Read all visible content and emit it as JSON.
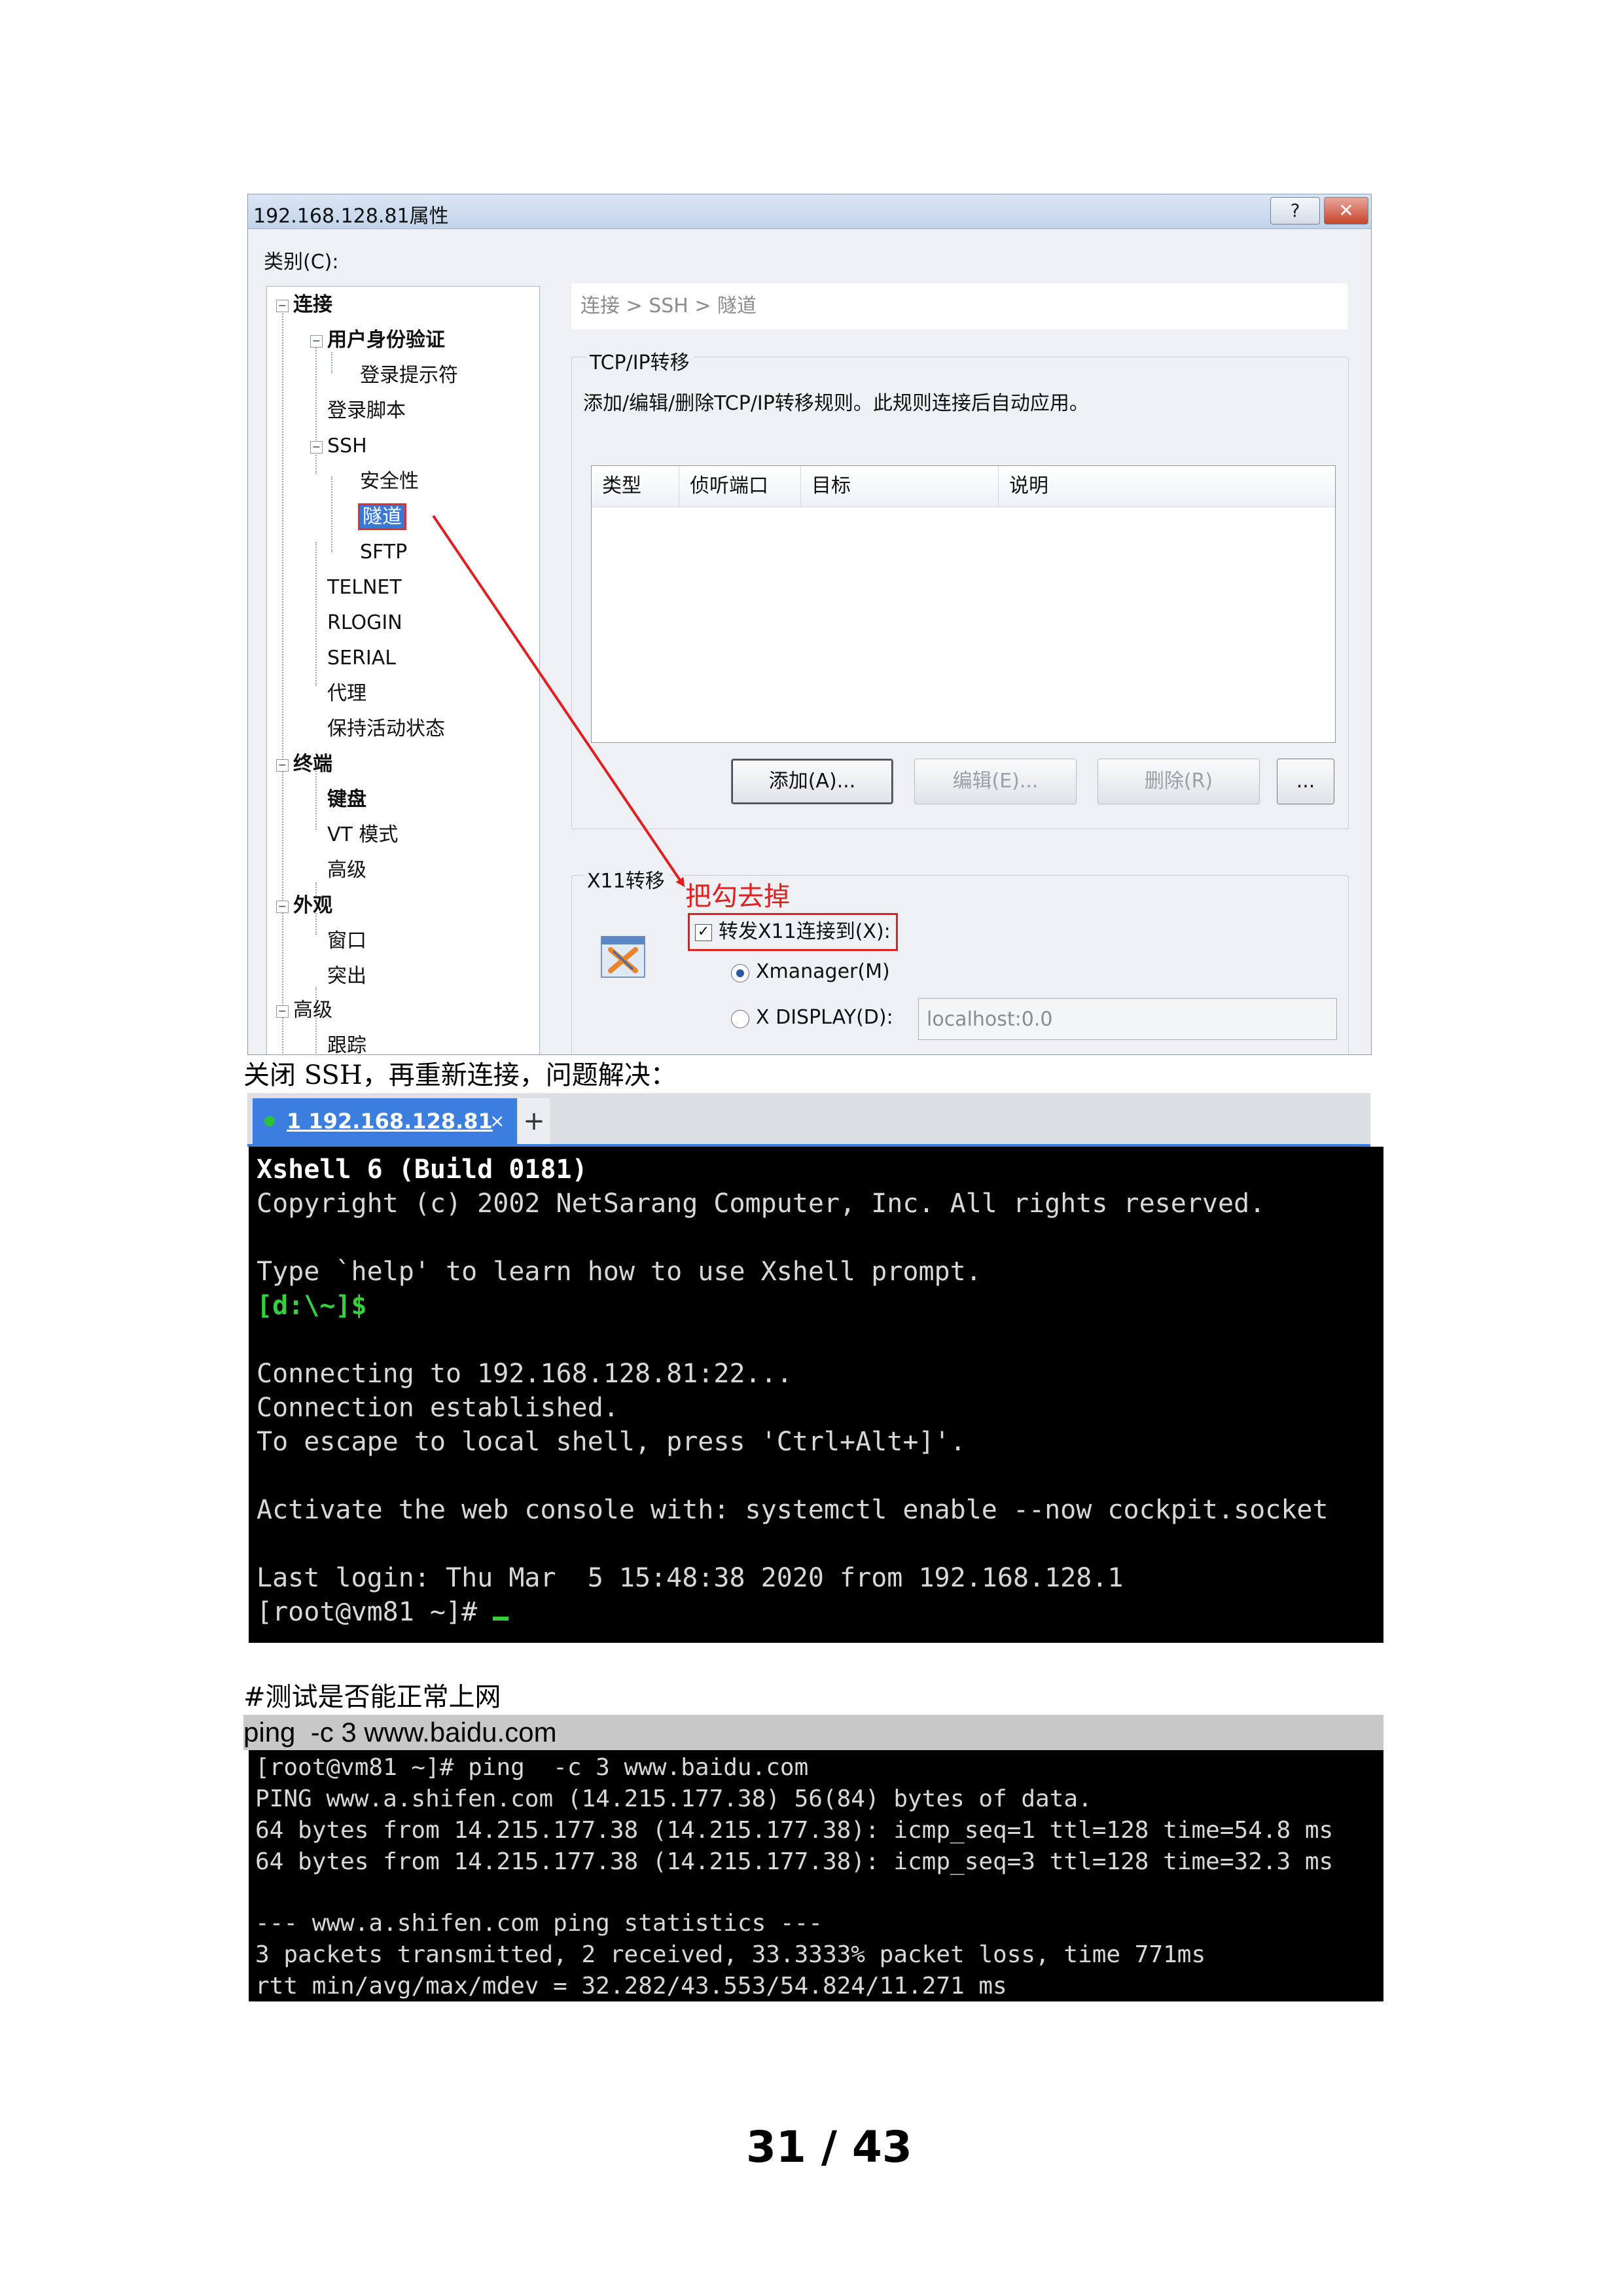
{
  "dialog": {
    "title": "192.168.128.81属性",
    "help_label": "?",
    "close_label": "✕",
    "category_label": "类别(C):",
    "tree": {
      "connection": "连接",
      "auth": "用户身份验证",
      "login_prompt": "登录提示符",
      "login_script": "登录脚本",
      "ssh": "SSH",
      "security": "安全性",
      "tunnel": "隧道",
      "sftp": "SFTP",
      "telnet": "TELNET",
      "rlogin": "RLOGIN",
      "serial": "SERIAL",
      "proxy": "代理",
      "keepalive": "保持活动状态",
      "terminal": "终端",
      "keyboard": "键盘",
      "vt_mode": "VT 模式",
      "advanced": "高级",
      "appearance": "外观",
      "window": "窗口",
      "highlight": "突出",
      "advanced2": "高级",
      "trace": "跟踪"
    },
    "breadcrumb": "连接 > SSH > 隧道",
    "tcp": {
      "title": "TCP/IP转移",
      "description": "添加/编辑/删除TCP/IP转移规则。此规则连接后自动应用。",
      "columns": [
        "类型",
        "侦听端口",
        "目标",
        "说明"
      ],
      "add_label": "添加(A)...",
      "edit_label": "编辑(E)...",
      "delete_label": "删除(R)",
      "more_label": "..."
    },
    "x11": {
      "title": "X11转移",
      "annotation": "把勾去掉",
      "forward_label": "转发X11连接到(X):",
      "forward_checked": true,
      "xmanager_label": "Xmanager(M)",
      "xdisplay_label": "X DISPLAY(D):",
      "display_value": "localhost:0.0",
      "selected": "xmanager"
    }
  },
  "text": {
    "close_ssh": "关闭 SSH，再重新连接，问题解决：",
    "test_internet": "#测试是否能正常上网",
    "ping_command": "ping  -c 3 www.baidu.com"
  },
  "xshell": {
    "tab_label": "1 192.168.128.81",
    "tab_close": "×",
    "new_tab": "+",
    "lines": [
      "Xshell 6 (Build 0181)",
      "Copyright (c) 2002 NetSarang Computer, Inc. All rights reserved.",
      "Type `help' to learn how to use Xshell prompt.",
      "[d:\\~]$",
      "Connecting to 192.168.128.81:22...",
      "Connection established.",
      "To escape to local shell, press 'Ctrl+Alt+]'.",
      "Activate the web console with: systemctl enable --now cockpit.socket",
      "Last login: Thu Mar  5 15:48:38 2020 from 192.168.128.1",
      "[root@vm81 ~]# "
    ]
  },
  "ping_output": {
    "lines": [
      "[root@vm81 ~]# ping  -c 3 www.baidu.com",
      "PING www.a.shifen.com (14.215.177.38) 56(84) bytes of data.",
      "64 bytes from 14.215.177.38 (14.215.177.38): icmp_seq=1 ttl=128 time=54.8 ms",
      "64 bytes from 14.215.177.38 (14.215.177.38): icmp_seq=3 ttl=128 time=32.3 ms",
      "--- www.a.shifen.com ping statistics ---",
      "3 packets transmitted, 2 received, 33.3333% packet loss, time 771ms",
      "rtt min/avg/max/mdev = 32.282/43.553/54.824/11.271 ms"
    ]
  },
  "page": {
    "number": "31 / 43"
  },
  "colors": {
    "accent": "#3c7de0",
    "annotation": "#e02020",
    "prompt_green": "#34d13b"
  }
}
